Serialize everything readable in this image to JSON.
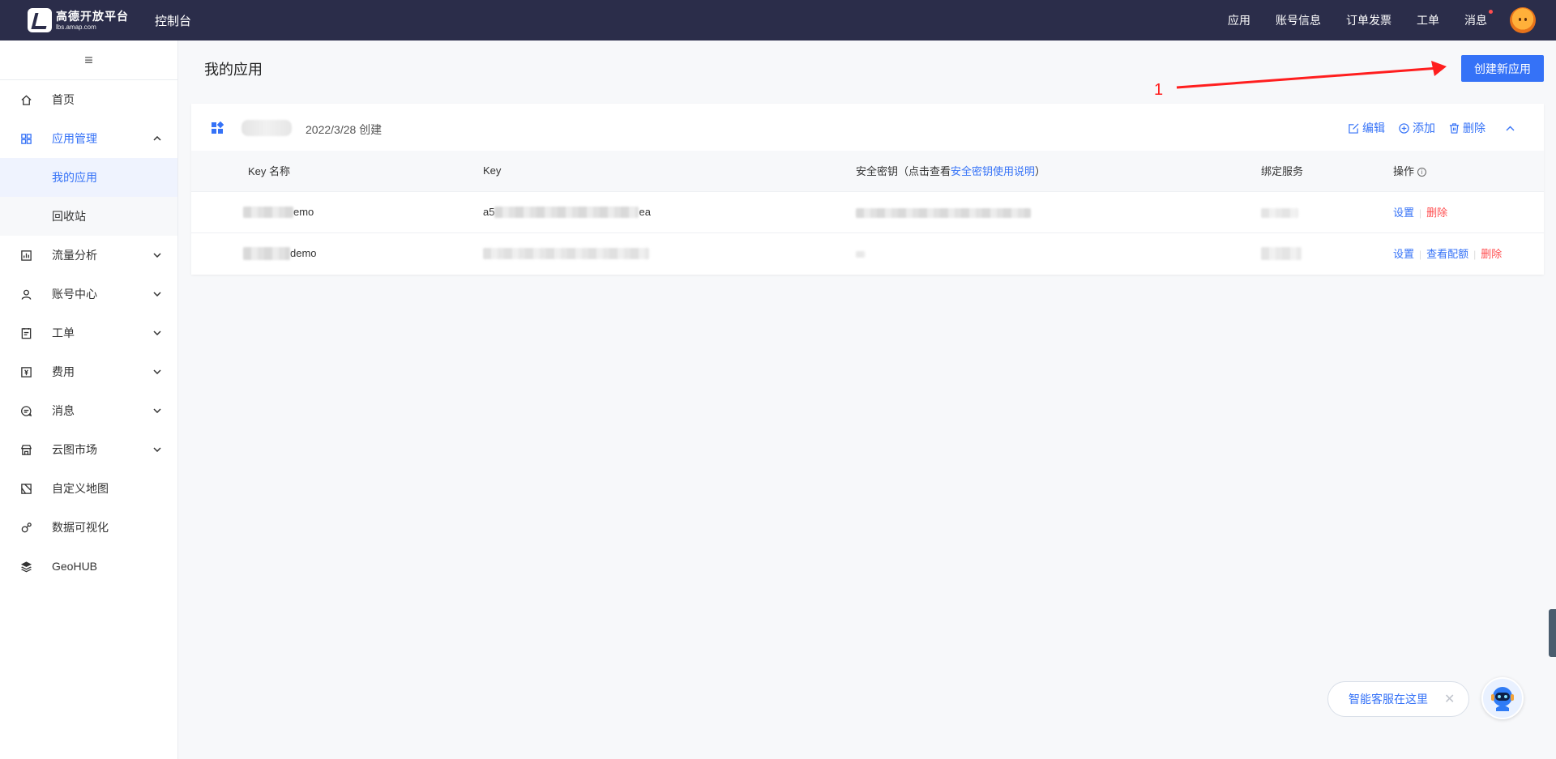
{
  "topbar": {
    "logo_line1": "高德开放平台",
    "logo_line2": "lbs.amap.com",
    "console_title": "控制台",
    "nav": [
      "应用",
      "账号信息",
      "订单发票",
      "工单",
      "消息"
    ]
  },
  "sidebar": {
    "toggle": "≡",
    "items": [
      {
        "label": "首页",
        "icon": "home-icon"
      },
      {
        "label": "应用管理",
        "icon": "grid-icon",
        "expanded": true
      },
      {
        "label": "流量分析",
        "icon": "chart-icon"
      },
      {
        "label": "账号中心",
        "icon": "user-icon"
      },
      {
        "label": "工单",
        "icon": "ticket-icon"
      },
      {
        "label": "费用",
        "icon": "fee-icon"
      },
      {
        "label": "消息",
        "icon": "message-icon"
      },
      {
        "label": "云图市场",
        "icon": "store-icon"
      },
      {
        "label": "自定义地图",
        "icon": "map-icon"
      },
      {
        "label": "数据可视化",
        "icon": "visual-icon"
      },
      {
        "label": "GeoHUB",
        "icon": "layers-icon"
      }
    ],
    "sub_items": [
      "我的应用",
      "回收站"
    ]
  },
  "main": {
    "page_title": "我的应用",
    "create_button": "创建新应用",
    "annotation_number": "1",
    "app": {
      "created": "2022/3/28 创建",
      "actions": [
        "编辑",
        "添加",
        "删除"
      ]
    },
    "table": {
      "headers": {
        "key_name": "Key 名称",
        "key": "Key",
        "secret_prefix": "安全密钥（点击查看",
        "secret_link": "安全密钥使用说明",
        "secret_suffix": "）",
        "service": "绑定服务",
        "ops": "操作"
      },
      "rows": [
        {
          "name_suffix": "emo",
          "key_prefix": "a5",
          "key_suffix": "ea",
          "ops": [
            "设置",
            "删除"
          ]
        },
        {
          "name_suffix": "demo",
          "key_prefix": "",
          "key_suffix": "",
          "ops": [
            "设置",
            "查看配额",
            "删除"
          ]
        }
      ]
    }
  },
  "chat": {
    "text": "智能客服在这里",
    "close": "✕"
  },
  "colors": {
    "topbar_bg": "#2b2d4a",
    "accent": "#3572f7",
    "danger": "#ff4d4f",
    "annotation": "#ff1e1e"
  }
}
